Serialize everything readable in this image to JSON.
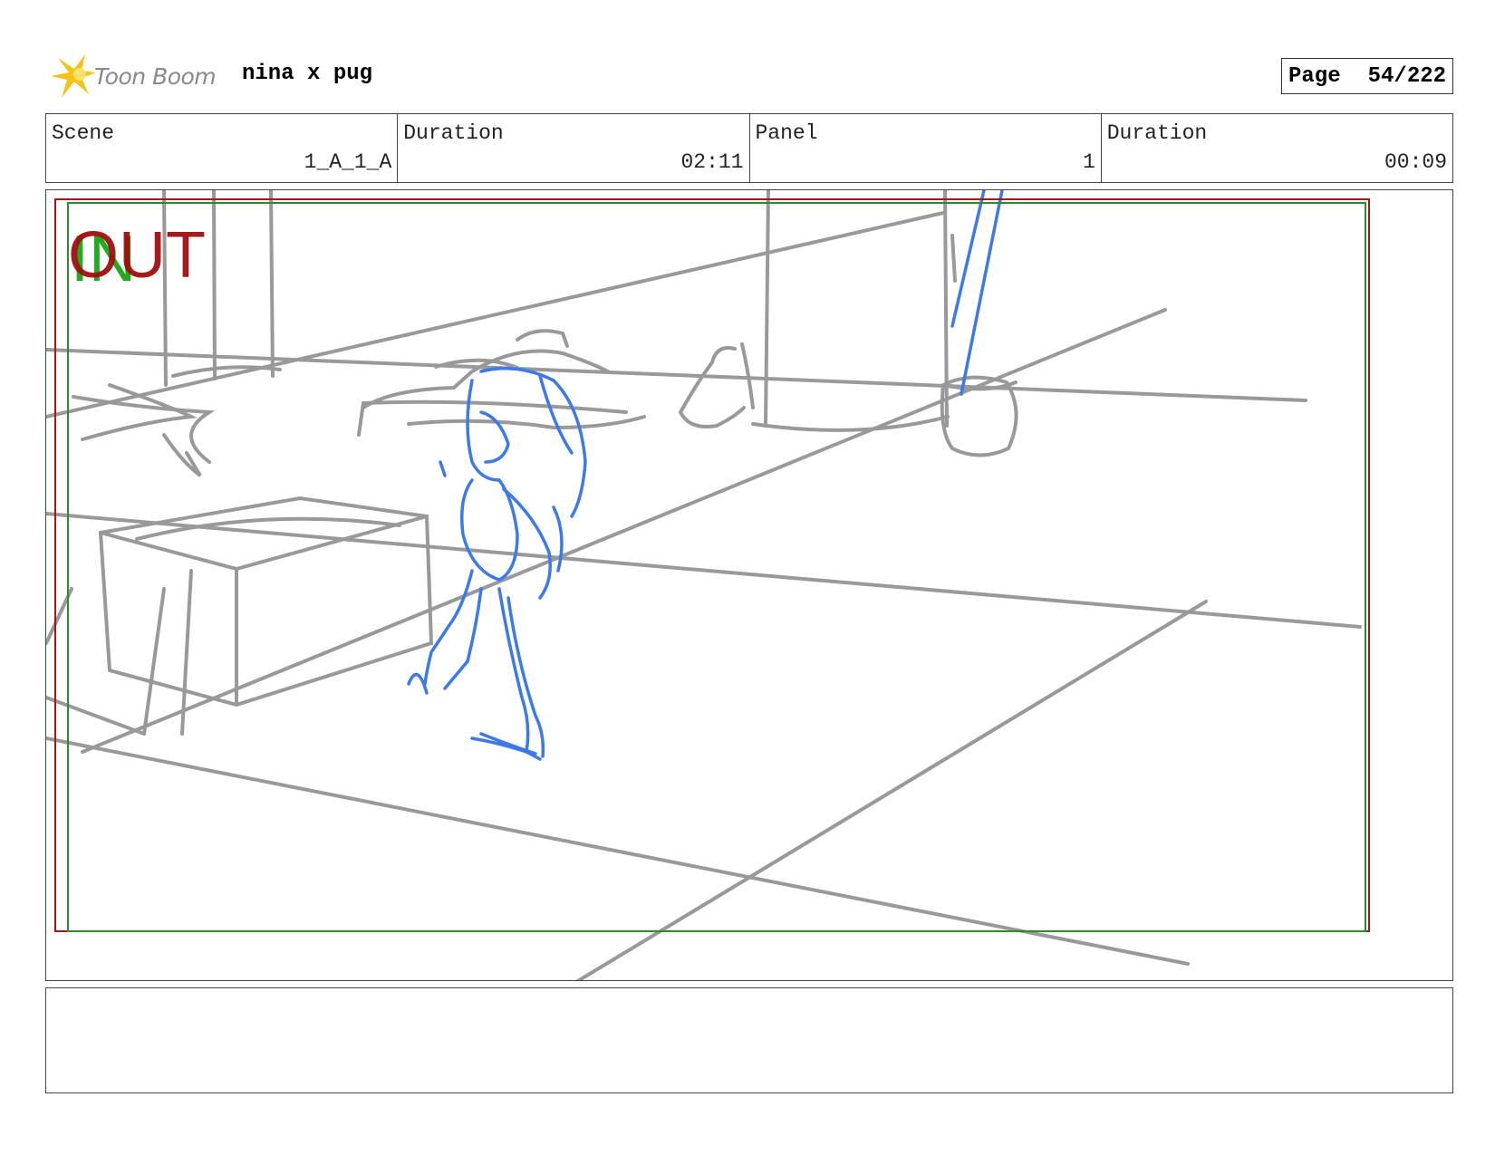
{
  "header": {
    "brand": "Toon Boom",
    "project_title": "nina x pug",
    "page_label": "Page",
    "page_number": "54/222"
  },
  "info": {
    "scene_label": "Scene",
    "scene_value": "1_A_1_A",
    "scene_duration_label": "Duration",
    "scene_duration_value": "02:11",
    "panel_label": "Panel",
    "panel_value": "1",
    "panel_duration_label": "Duration",
    "panel_duration_value": "00:09"
  },
  "frame": {
    "in_label": "IN",
    "out_label": "OUT"
  },
  "colors": {
    "sketch_gray": "#999999",
    "character_blue": "#3b7ae8",
    "safe_red": "#a01818",
    "safe_green": "#2e8a2e",
    "in_green": "#22aa22",
    "out_red": "#a00f0f",
    "logo_yellow": "#f5c316"
  },
  "notes": {
    "text": ""
  }
}
